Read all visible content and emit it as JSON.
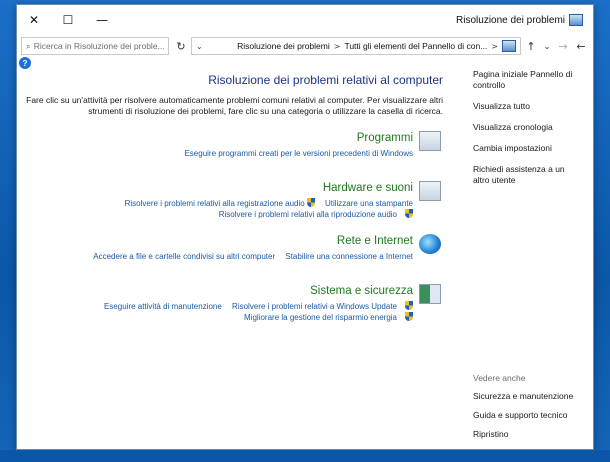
{
  "window": {
    "title": "Risoluzione dei problemi",
    "minimize_glyph": "—",
    "maximize_glyph": "☐",
    "close_glyph": "✕"
  },
  "address": {
    "path_1": "Tutti gli elementi del Pannello di con...",
    "separator": ">",
    "path_2": "Risoluzione dei problemi",
    "search_placeholder": "Ricerca in Risoluzione dei proble...",
    "back_glyph": "←",
    "forward_glyph": "→",
    "up_glyph": "↑",
    "recent_glyph": "⌄",
    "refresh_glyph": "↻",
    "search_icon_glyph": "⌕"
  },
  "help_glyph": "?",
  "navpane": {
    "items": [
      {
        "label": "Pagina iniziale Pannello di controllo"
      },
      {
        "label": "Visualizza tutto"
      },
      {
        "label": "Visualizza cronologia"
      },
      {
        "label": "Cambia impostazioni"
      },
      {
        "label": "Richiedi assistenza a un altro utente"
      }
    ],
    "see_also_heading": "Vedere anche",
    "see_also": [
      {
        "label": "Sicurezza e manutenzione"
      },
      {
        "label": "Guida e supporto tecnico"
      },
      {
        "label": "Ripristino"
      }
    ]
  },
  "main": {
    "title": "Risoluzione dei problemi relativi al computer",
    "description": "Fare clic su un'attività per risolvere automaticamente problemi comuni relativi al computer. Per visualizzare altri strumenti di risoluzione dei problemi, fare clic su una categoria o utilizzare la casella di ricerca.",
    "categories": [
      {
        "title": "Programmi",
        "icon": "programs-icon",
        "links": [
          "Eseguire programmi creati per le versioni precedenti di Windows"
        ]
      },
      {
        "title": "Hardware e suoni",
        "icon": "hardware-icon",
        "links": [
          "Utilizzare una stampante",
          "Risolvere i problemi relativi alla registrazione audio",
          "Risolvere i problemi relativi alla riproduzione audio"
        ]
      },
      {
        "title": "Rete e Internet",
        "icon": "network-globe-icon",
        "links": [
          "Stabilire una connessione a Internet",
          "Accedere a file e cartelle condivisi su altri computer"
        ]
      },
      {
        "title": "Sistema e sicurezza",
        "icon": "system-security-icon",
        "links": [
          "Risolvere i problemi relativi a Windows Update",
          "Eseguire attività di manutenzione",
          "Migliorare la gestione del risparmio energia"
        ]
      }
    ]
  }
}
